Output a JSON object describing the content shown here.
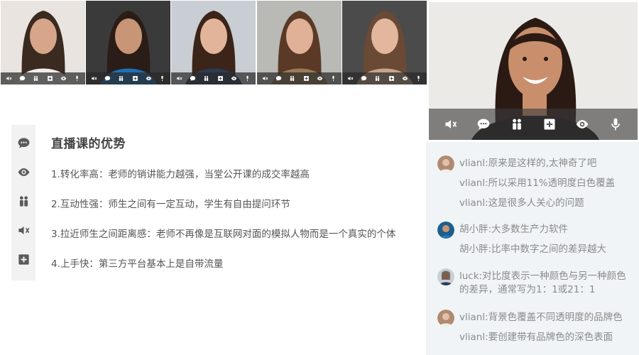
{
  "toolbar_icons": [
    "mute-icon",
    "chat-icon",
    "participants-icon",
    "add-icon",
    "view-icon",
    "mic-icon"
  ],
  "thumbnails": [
    {
      "name": "participant-1",
      "bg": "#e9e4df",
      "skin": "#d6a58a",
      "hair": "#3a2a20",
      "top": "#f1ede8"
    },
    {
      "name": "participant-2",
      "bg": "#3b3a3a",
      "skin": "#c89576",
      "hair": "#2a1d17",
      "top": "#1f6fb5"
    },
    {
      "name": "participant-3",
      "bg": "#c9ced4",
      "skin": "#e2b59b",
      "hair": "#3b2418",
      "top": "#2d3a52"
    },
    {
      "name": "participant-4",
      "bg": "#b9b9b6",
      "skin": "#e0b196",
      "hair": "#5a3a26",
      "top": "#9b7b57"
    },
    {
      "name": "participant-5",
      "bg": "#4b4b4b",
      "skin": "#e3b79d",
      "hair": "#6a4a34",
      "top": "#c5a48e"
    }
  ],
  "main_video": {
    "bg": "#eceae7",
    "skin": "#c98f6c",
    "hair": "#2b1a14",
    "top": "#141414"
  },
  "content": {
    "title": "直播课的优势",
    "points": [
      "1.转化率高：老师的销讲能力越强，当堂公开课的成交率越高",
      "2.互动性强：师生之间有一定互动，学生有自由提问环节",
      "3.拉近师生之间距离感：老师不再像是互联网对面的模拟人物而是一个真实的个体",
      "4.上手快：第三方平台基本上是自带流量"
    ]
  },
  "chat": {
    "messages": [
      {
        "lines": [
          "vlianl:原来是这样的,太神奇了吧",
          "vlianl:所以采用11%透明度白色覆盖",
          "vlianl:这是很多人关心的问题"
        ],
        "avatar_bg": "#b08a70"
      },
      {
        "lines": [
          "胡小胖:大多数生产力软件",
          "胡小胖:比率中数字之间的差异越大"
        ],
        "avatar_bg": "#1d5e8a"
      },
      {
        "lines": [
          "luck:对比度表示一种颜色与另一种颜色的差异，通常写为1：1或21：1"
        ],
        "avatar_bg": "#7d8a95"
      },
      {
        "lines": [
          "vlianl:背景色覆盖不同透明度的品牌色",
          "vlianl:要创建带有品牌色的深色表面"
        ],
        "avatar_bg": "#b08a70"
      }
    ]
  }
}
